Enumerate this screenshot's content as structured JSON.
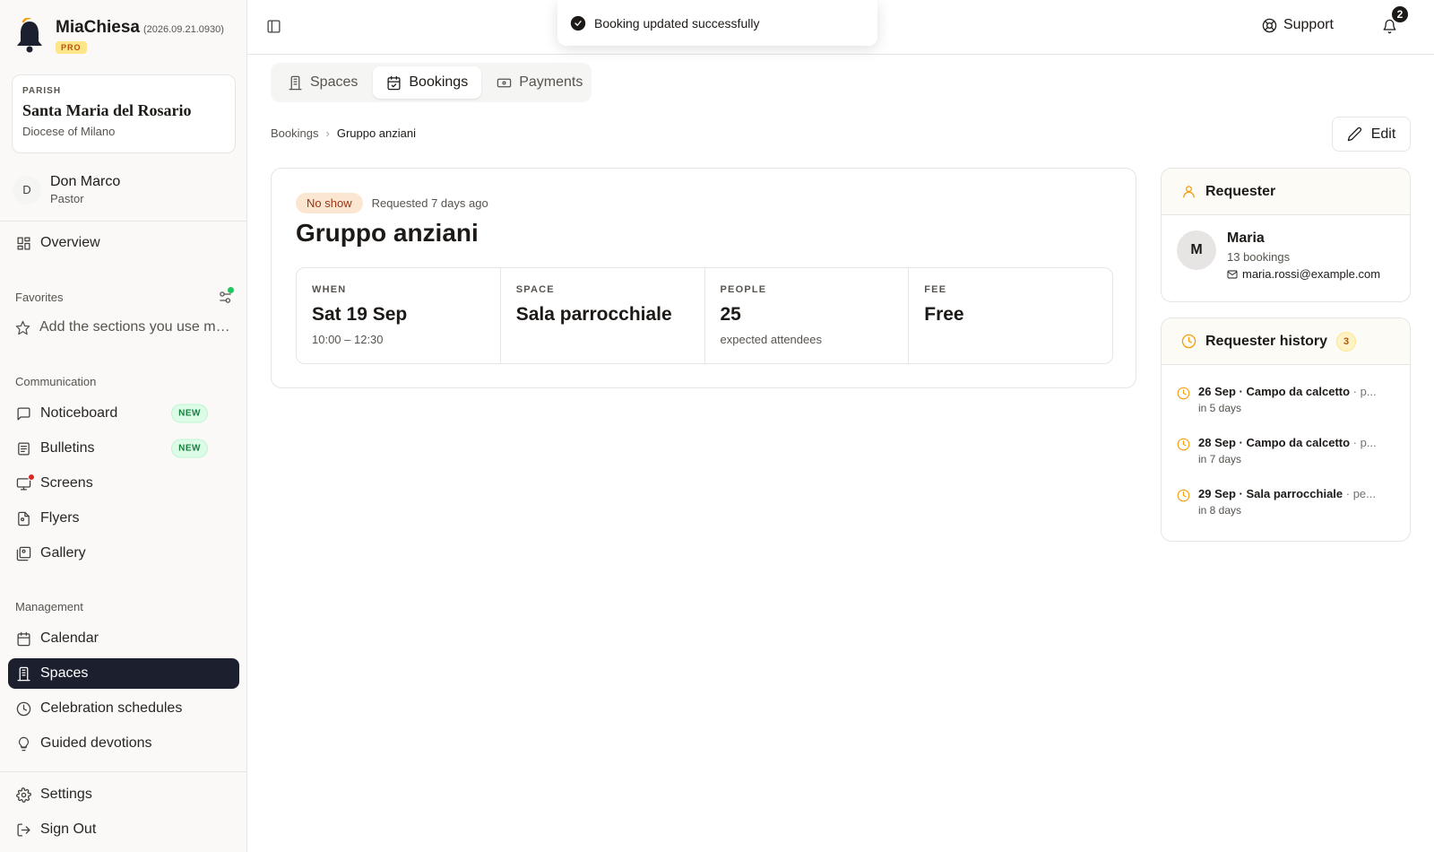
{
  "app": {
    "name": "MiaChiesa",
    "version": "(2026.09.21.0930)",
    "plan_badge": "PRO"
  },
  "parish": {
    "label": "PARISH",
    "name": "Santa Maria del Rosario",
    "diocese": "Diocese of Milano"
  },
  "user": {
    "initial": "D",
    "name": "Don Marco",
    "role": "Pastor"
  },
  "sidebar": {
    "overview": "Overview",
    "favorites_label": "Favorites",
    "favorites_hint": "Add the sections you use most",
    "communication_label": "Communication",
    "communication": [
      {
        "label": "Noticeboard",
        "badge": "NEW",
        "icon": "message-square-icon"
      },
      {
        "label": "Bulletins",
        "badge": "NEW",
        "icon": "newspaper-icon"
      },
      {
        "label": "Screens",
        "icon": "monitor-icon"
      },
      {
        "label": "Flyers",
        "icon": "file-image-icon"
      },
      {
        "label": "Gallery",
        "icon": "images-icon"
      }
    ],
    "management_label": "Management",
    "management": [
      {
        "label": "Calendar",
        "icon": "calendar-icon"
      },
      {
        "label": "Spaces",
        "icon": "building-icon",
        "active": true
      },
      {
        "label": "Celebration schedules",
        "icon": "clock-icon"
      },
      {
        "label": "Guided devotions",
        "icon": "lightbulb-icon"
      }
    ],
    "settings": "Settings",
    "sign_out": "Sign Out"
  },
  "topbar": {
    "support": "Support",
    "notification_count": "2"
  },
  "toast": {
    "message": "Booking updated successfully"
  },
  "tabs": [
    {
      "label": "Spaces",
      "icon": "building-icon"
    },
    {
      "label": "Bookings",
      "icon": "calendar-check-icon",
      "active": true
    },
    {
      "label": "Payments",
      "icon": "banknote-icon"
    }
  ],
  "breadcrumb": {
    "parent": "Bookings",
    "current": "Gruppo anziani"
  },
  "edit_label": "Edit",
  "booking": {
    "status": "No show",
    "requested": "Requested 7 days ago",
    "title": "Gruppo anziani",
    "stats": [
      {
        "label": "WHEN",
        "value": "Sat 19 Sep",
        "sub": "10:00 – 12:30"
      },
      {
        "label": "SPACE",
        "value": "Sala parrocchiale",
        "sub": ""
      },
      {
        "label": "PEOPLE",
        "value": "25",
        "sub": "expected attendees"
      },
      {
        "label": "FEE",
        "value": "Free",
        "sub": ""
      }
    ]
  },
  "requester": {
    "heading": "Requester",
    "initial": "M",
    "name": "Maria",
    "bookings": "13 bookings",
    "email": "maria.rossi@example.com"
  },
  "history": {
    "heading": "Requester history",
    "count": "3",
    "items": [
      {
        "main": "26 Sep · Campo da calcetto",
        "extra": " · p...",
        "sub": "in 5 days"
      },
      {
        "main": "28 Sep · Campo da calcetto",
        "extra": " · p...",
        "sub": "in 7 days"
      },
      {
        "main": "29 Sep · Sala parrocchiale",
        "extra": " · pe...",
        "sub": "in 8 days"
      }
    ]
  }
}
